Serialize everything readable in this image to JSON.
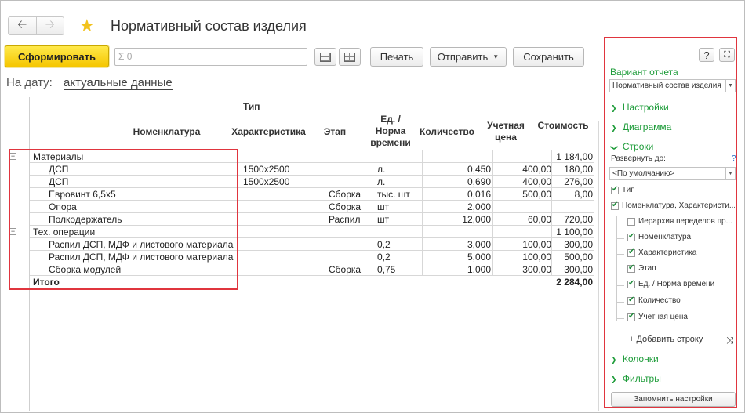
{
  "header": {
    "back_icon": "arrow-left-icon",
    "forward_icon": "arrow-right-icon",
    "favorite_icon": "star-icon",
    "title": "Нормативный состав изделия"
  },
  "toolbar": {
    "generate_label": "Сформировать",
    "sum_placeholder": "Σ 0",
    "print_label": "Печать",
    "send_label": "Отправить",
    "save_label": "Сохранить"
  },
  "date": {
    "label": "На дату:",
    "value": "актуальные данные"
  },
  "report": {
    "group_header": "Тип",
    "columns": {
      "nomenclature": "Номенклатура",
      "characteristic": "Характеристика",
      "stage": "Этап",
      "unit": "Ед. / Норма времени",
      "quantity": "Количество",
      "price": "Учетная цена",
      "cost": "Стоимость"
    },
    "rows": [
      {
        "type": "group",
        "name": "Материалы",
        "char": "",
        "stage": "",
        "unit": "",
        "qty": "",
        "price": "",
        "cost": "1 184,00"
      },
      {
        "type": "item",
        "name": "ДСП",
        "char": "1500x2500",
        "stage": "",
        "unit": "л.",
        "qty": "0,450",
        "price": "400,00",
        "cost": "180,00"
      },
      {
        "type": "item",
        "name": "ДСП",
        "char": "1500x2500",
        "stage": "",
        "unit": "л.",
        "qty": "0,690",
        "price": "400,00",
        "cost": "276,00"
      },
      {
        "type": "item",
        "name": "Евровинт 6,5x5",
        "char": "",
        "stage": "Сборка",
        "unit": "тыс. шт",
        "qty": "0,016",
        "price": "500,00",
        "cost": "8,00"
      },
      {
        "type": "item",
        "name": "Опора",
        "char": "",
        "stage": "Сборка",
        "unit": "шт",
        "qty": "2,000",
        "price": "",
        "cost": ""
      },
      {
        "type": "item",
        "name": "Полкодержатель",
        "char": "",
        "stage": "Распил",
        "unit": "шт",
        "qty": "12,000",
        "price": "60,00",
        "cost": "720,00"
      },
      {
        "type": "group",
        "name": "Тех. операции",
        "char": "",
        "stage": "",
        "unit": "",
        "qty": "",
        "price": "",
        "cost": "1 100,00"
      },
      {
        "type": "item",
        "name": "Распил ДСП, МДФ и листового материала",
        "char": "",
        "stage": "",
        "unit": "0,2",
        "qty": "3,000",
        "price": "100,00",
        "cost": "300,00"
      },
      {
        "type": "item",
        "name": "Распил ДСП, МДФ и листового материала",
        "char": "",
        "stage": "",
        "unit": "0,2",
        "qty": "5,000",
        "price": "100,00",
        "cost": "500,00"
      },
      {
        "type": "item",
        "name": "Сборка модулей",
        "char": "",
        "stage": "Сборка",
        "unit": "0,75",
        "qty": "1,000",
        "price": "300,00",
        "cost": "300,00"
      },
      {
        "type": "total",
        "name": "Итого",
        "char": "",
        "stage": "",
        "unit": "",
        "qty": "",
        "price": "",
        "cost": "2 284,00"
      }
    ]
  },
  "panel": {
    "help_label": "?",
    "expand_icon": "fullscreen-icon",
    "variant_label": "Вариант отчета",
    "variant_value": "Нормативный состав изделия",
    "sections": {
      "settings": "Настройки",
      "chart": "Диаграмма",
      "rows": "Строки",
      "columns": "Колонки",
      "filters": "Фильтры"
    },
    "expand_to_label": "Развернуть до:",
    "expand_help": "?",
    "expand_to_value": "<По умолчанию>",
    "row_items": [
      {
        "label": "Тип",
        "checked": true,
        "level": 0
      },
      {
        "label": "Номенклатура, Характеристи...",
        "checked": true,
        "level": 0
      },
      {
        "label": "Иерархия переделов пр...",
        "checked": false,
        "level": 1
      },
      {
        "label": "Номенклатура",
        "checked": true,
        "level": 1
      },
      {
        "label": "Характеристика",
        "checked": true,
        "level": 1
      },
      {
        "label": "Этап",
        "checked": true,
        "level": 1
      },
      {
        "label": "Ед. / Норма времени",
        "checked": true,
        "level": 1
      },
      {
        "label": "Количество",
        "checked": true,
        "level": 1
      },
      {
        "label": "Учетная цена",
        "checked": true,
        "level": 1
      }
    ],
    "add_row_label": "+ Добавить строку",
    "remember_label": "Запомнить настройки"
  },
  "colors": {
    "primary_button": "#f5c600",
    "accent_green": "#1e9c3a",
    "highlight_red": "#e0353e"
  }
}
